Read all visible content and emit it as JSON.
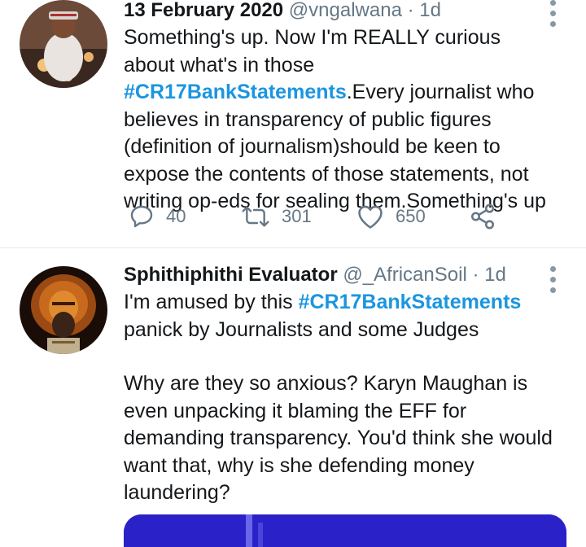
{
  "tweets": [
    {
      "date": "13 February 2020",
      "handle": "@vngalwana",
      "age": "1d",
      "text": {
        "before": "Something's up. Now I'm REALLY curious about what's in those ",
        "hashtag": "#CR17BankStatements",
        "after": ".Every journalist who believes in transparency of public figures (definition of journalism)should be keen to expose the contents of those statements, not writing op-eds for sealing them.Something's up"
      },
      "replies": "40",
      "retweets": "301",
      "likes": "650",
      "icons": [
        "comment-icon",
        "retweet-icon",
        "heart-icon",
        "share-icon",
        "more-icon"
      ]
    },
    {
      "name": "Sphithiphithi Evaluator",
      "handle": "@_AfricanSoil",
      "age": "1d",
      "text": {
        "before": "I'm amused by this ",
        "hashtag": "#CR17BankStatements",
        "after": " panick by Journalists and some Judges",
        "paragraph2": "Why are they so anxious? Karyn Maughan is even unpacking it blaming the EFF for demanding transparency. You'd think she would want that, why is she defending money laundering?"
      },
      "icons": [
        "more-icon"
      ]
    }
  ],
  "separator": "·",
  "colors": {
    "hashtag": "#1b95e0",
    "secondary_text": "#657786",
    "divider": "#e1e8ed",
    "media": "#2a22c8"
  }
}
